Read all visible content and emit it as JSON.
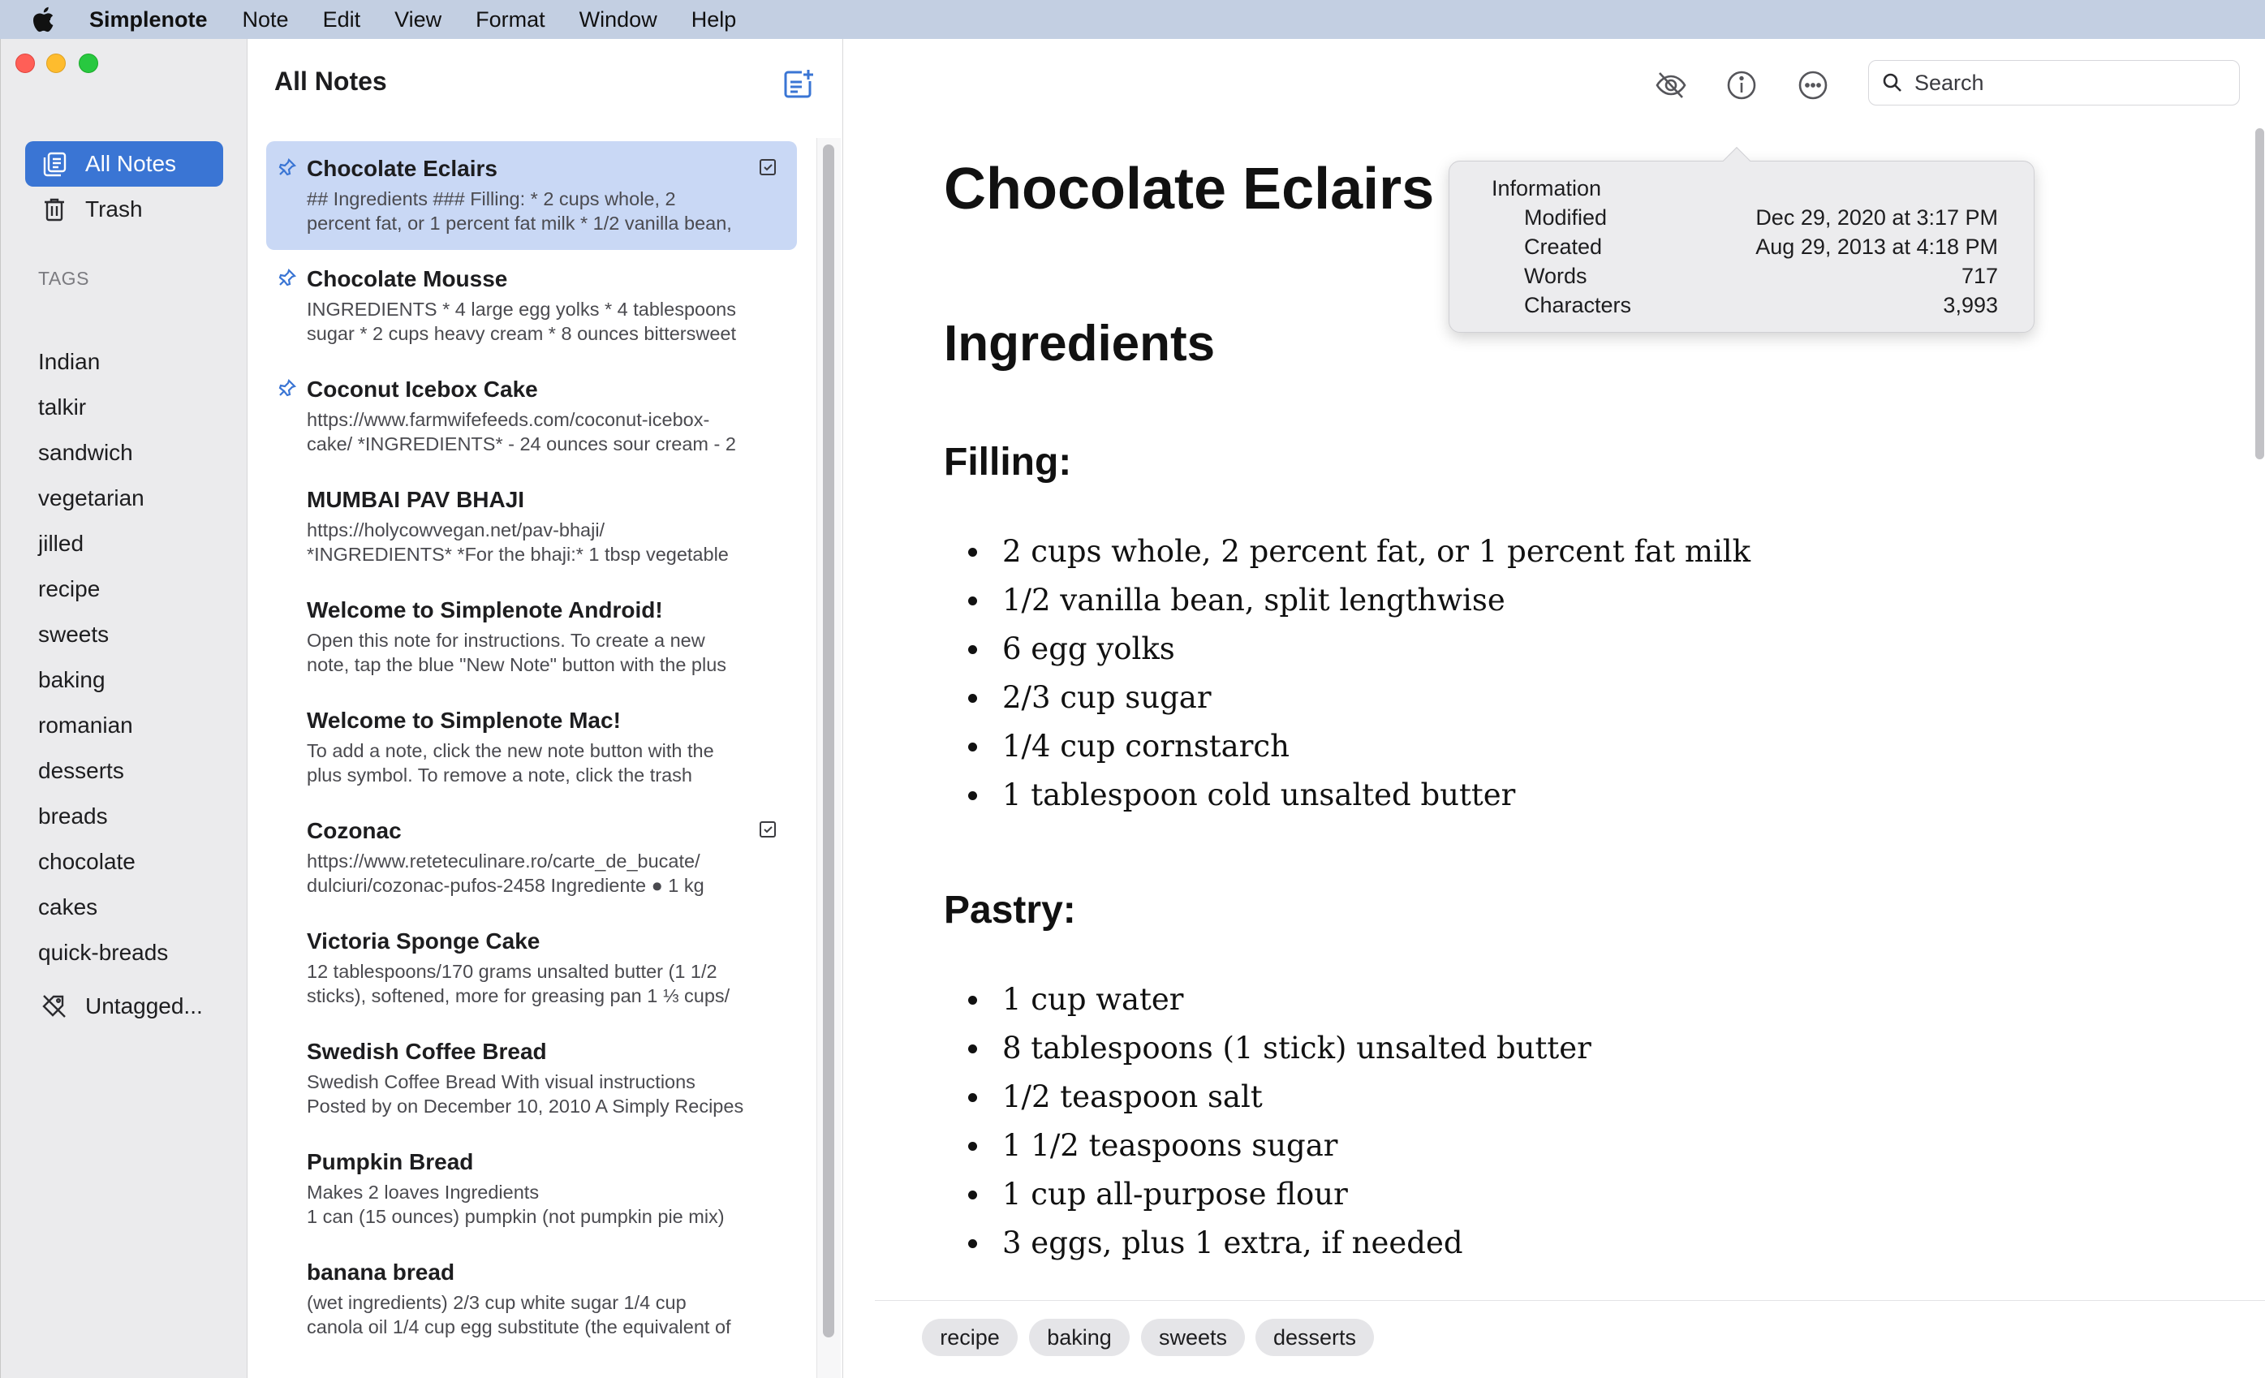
{
  "menubar": {
    "app_name": "Simplenote",
    "items": [
      "Note",
      "Edit",
      "View",
      "Format",
      "Window",
      "Help"
    ]
  },
  "sidebar": {
    "nav": [
      {
        "label": "All Notes",
        "icon": "notes-icon",
        "active": true
      },
      {
        "label": "Trash",
        "icon": "trash-icon",
        "active": false
      }
    ],
    "tags_header": "TAGS",
    "tags": [
      "Indian",
      "talkir",
      "sandwich",
      "vegetarian",
      "jilled",
      "recipe",
      "sweets",
      "baking",
      "romanian",
      "desserts",
      "breads",
      "chocolate",
      "cakes",
      "quick-breads"
    ],
    "untagged_label": "Untagged..."
  },
  "note_list": {
    "title": "All Notes",
    "notes": [
      {
        "title": "Chocolate Eclairs",
        "line1": "## Ingredients ### Filling: * 2 cups whole, 2",
        "line2": "percent fat, or 1 percent fat milk * 1/2 vanilla bean,",
        "pinned": true,
        "checklist": true,
        "selected": true
      },
      {
        "title": "Chocolate Mousse",
        "line1": "INGREDIENTS * 4 large egg yolks * 4 tablespoons",
        "line2": "sugar * 2 cups heavy cream * 8 ounces bittersweet",
        "pinned": true,
        "checklist": false,
        "selected": false
      },
      {
        "title": "Coconut Icebox Cake",
        "line1": "https://www.farmwifefeeds.com/coconut-icebox-",
        "line2": "cake/ *INGREDIENTS* - 24 ounces sour cream - 2",
        "pinned": true,
        "checklist": false,
        "selected": false
      },
      {
        "title": "MUMBAI PAV BHAJI",
        "line1": "https://holycowvegan.net/pav-bhaji/",
        "line2": "*INGREDIENTS* *For the bhaji:* 1 tbsp vegetable",
        "pinned": false,
        "checklist": false,
        "selected": false
      },
      {
        "title": "Welcome to Simplenote Android!",
        "line1": "Open this note for instructions. To create a new",
        "line2": "note, tap the blue \"New Note\" button with the plus",
        "pinned": false,
        "checklist": false,
        "selected": false
      },
      {
        "title": "Welcome to Simplenote Mac!",
        "line1": "To add a note, click the new note button with the",
        "line2": "plus symbol. To remove a note, click the trash",
        "pinned": false,
        "checklist": false,
        "selected": false
      },
      {
        "title": "Cozonac",
        "line1": "https://www.reteteculinare.ro/carte_de_bucate/",
        "line2": "dulciuri/cozonac-pufos-2458 Ingrediente ● 1 kg",
        "pinned": false,
        "checklist": true,
        "selected": false
      },
      {
        "title": "Victoria Sponge Cake",
        "line1": "12 tablespoons/170 grams unsalted butter (1 1/2",
        "line2": "sticks), softened, more for greasing pan 1 ⅓ cups/",
        "pinned": false,
        "checklist": false,
        "selected": false
      },
      {
        "title": "Swedish Coffee Bread",
        "line1": "Swedish Coffee Bread With visual instructions",
        "line2": "Posted by on December 10, 2010 A Simply Recipes",
        "pinned": false,
        "checklist": false,
        "selected": false
      },
      {
        "title": "Pumpkin Bread",
        "line1": "Makes 2 loaves Ingredients",
        "line2": "1 can (15 ounces) pumpkin (not pumpkin pie mix)",
        "pinned": false,
        "checklist": false,
        "selected": false
      },
      {
        "title": "banana bread",
        "line1": "(wet ingredients) 2/3 cup white sugar 1/4 cup",
        "line2": "canola oil 1/4 cup egg substitute (the equivalent of",
        "pinned": false,
        "checklist": false,
        "selected": false
      }
    ]
  },
  "toolbar": {
    "search_placeholder": "Search",
    "icons": [
      "preview-hidden-icon",
      "info-icon",
      "more-icon"
    ]
  },
  "document": {
    "title": "Chocolate Eclairs",
    "section": "Ingredients",
    "filling_heading": "Filling:",
    "filling": [
      "2 cups whole, 2 percent fat, or 1 percent fat milk",
      "1/2 vanilla bean, split lengthwise",
      "6 egg yolks",
      "2/3 cup sugar",
      "1/4 cup cornstarch",
      "1 tablespoon cold unsalted butter"
    ],
    "pastry_heading": "Pastry:",
    "pastry": [
      "1 cup water",
      "8 tablespoons (1 stick) unsalted butter",
      "1/2 teaspoon salt",
      "1 1/2 teaspoons sugar",
      "1 cup all-purpose flour",
      "3 eggs, plus 1 extra, if needed"
    ]
  },
  "note_tags": [
    "recipe",
    "baking",
    "sweets",
    "desserts"
  ],
  "info": {
    "heading": "Information",
    "rows": [
      {
        "key": "Modified",
        "value": "Dec 29, 2020 at 3:17 PM"
      },
      {
        "key": "Created",
        "value": "Aug 29, 2013 at 4:18 PM"
      },
      {
        "key": "Words",
        "value": "717"
      },
      {
        "key": "Characters",
        "value": "3,993"
      }
    ]
  },
  "colors": {
    "accent": "#3a75d4",
    "selected_note": "#c9d8f5",
    "sidebar_bg": "#ebebed",
    "menubar_bg": "#c3cfe2"
  }
}
